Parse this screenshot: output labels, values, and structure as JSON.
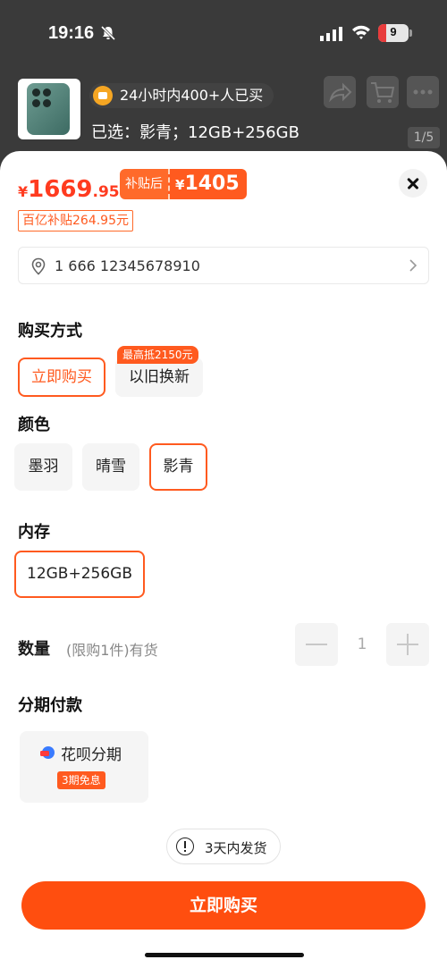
{
  "status_bar": {
    "time": "19:16",
    "battery": "9"
  },
  "header": {
    "tag": "24小时内400+人已买",
    "selected": "已选：影青；12GB+256GB",
    "pager": "1/5"
  },
  "price": {
    "currency": "¥",
    "integer": "1669",
    "decimal": ".95",
    "subsidy_label": "补贴后",
    "subsidy_currency": "¥",
    "subsidy_price": "1405",
    "subsidy_badge": "百亿补贴264.95元"
  },
  "address": {
    "text": "1 666 12345678910"
  },
  "purchase_method": {
    "title": "购买方式",
    "options": [
      {
        "label": "立即购买",
        "selected": true
      },
      {
        "label": "以旧换新",
        "selected": false
      }
    ],
    "trade_in_bubble": "最高抵2150元"
  },
  "color": {
    "title": "颜色",
    "options": [
      {
        "label": "墨羽",
        "selected": false
      },
      {
        "label": "晴雪",
        "selected": false
      },
      {
        "label": "影青",
        "selected": true
      }
    ]
  },
  "memory": {
    "title": "内存",
    "options": [
      {
        "label": "12GB+256GB",
        "selected": true
      }
    ]
  },
  "quantity": {
    "title": "数量",
    "note": "(限购1件)有货",
    "value": "1"
  },
  "installment": {
    "title": "分期付款",
    "name": "花呗分期",
    "badge": "3期免息"
  },
  "shipping": {
    "text": "3天内发货"
  },
  "buy_button": {
    "label": "立即购买"
  },
  "colors": {
    "accent": "#ff4e0f",
    "price": "#ff3b1f"
  }
}
